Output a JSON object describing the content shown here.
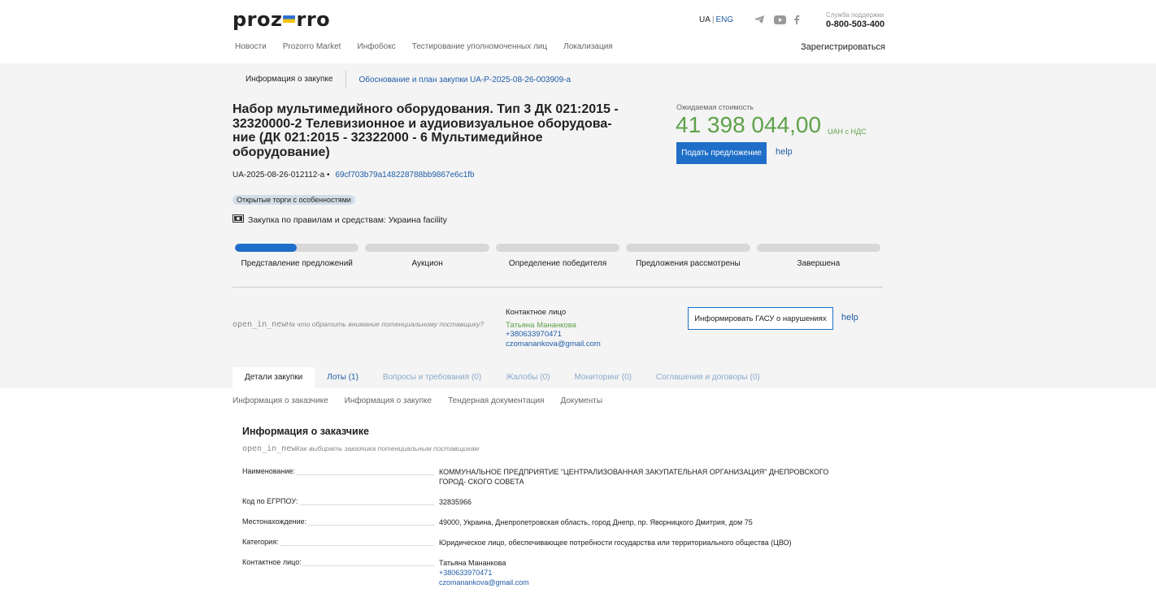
{
  "header": {
    "logo": "prozorro",
    "lang_ua": "UA",
    "lang_eng": "ENG",
    "support_label": "Служба поддержки",
    "support_phone": "0-800-503-400",
    "nav": [
      "Новости",
      "Prozorro Market",
      "Инфобокс",
      "Тестирование уполномоченных лиц",
      "Локализация"
    ],
    "register": "Зарегистрироваться",
    "icons": [
      "telegram-icon",
      "youtube-icon",
      "facebook-icon"
    ]
  },
  "subtabs": {
    "info": "Информация о закупке",
    "plan": "Обоснование и план закупки UA-P-2025-08-26-003909-a"
  },
  "tender": {
    "title": "Набор мультимедийного оборудования. Тип 3 ДК 021:2015 - 32320000-2 Телевизионное и аудиовизуальное оборудова- ние (ДК 021:2015 - 32322000 - 6 Мультимедийное оборудование)",
    "id": "UA-2025-08-26-012112-a",
    "bullet": "•",
    "hash": "69cf703b79a148228788bb9867e6c1fb",
    "badge": "Открытые торги с особенностями",
    "rules": "Закупка по правилам и средствам: Украина facility",
    "expected_label": "Ожидаемая стоимость",
    "price": "41 398 044,00",
    "currency": "UAH с НДС",
    "offer_button": "Подать предложение",
    "help": "help"
  },
  "progress": {
    "current_fraction": 0.5,
    "steps": [
      "Представление предложений",
      "Аукцион",
      "Определение победителя",
      "Предложения рассмотрены",
      "Завершена"
    ]
  },
  "notice": {
    "open_icon_text": "open_in_new",
    "hint": "На что обратить внимание потенциальному поставщику?",
    "contact_header": "Контактное лицо",
    "contact_name": "Татьяна Мананкова",
    "contact_phone": "+380633970471",
    "contact_email": "czomanankova@gmail.com",
    "gasu_button": "Информировать ГАСУ о нарушениях",
    "help": "help"
  },
  "tabs": [
    {
      "label": "Детали закупки"
    },
    {
      "label": "Лоты (1)"
    },
    {
      "label": "Вопросы и требования (0)"
    },
    {
      "label": "Жалобы (0)"
    },
    {
      "label": "Мониторинг (0)"
    },
    {
      "label": "Соглашения и договоры (0)"
    }
  ],
  "subnav": [
    "Информация о заказчике",
    "Информация о закупке",
    "Тендерная документация",
    "Документы"
  ],
  "customer": {
    "title": "Информация о заказчике",
    "open_icon_text": "open_in_new",
    "hint": "Как выбирать заказчика потенциальным поставщикам",
    "rows": [
      {
        "key": "Наименование:",
        "value": "КОММУНАЛЬНОЕ ПРЕДПРИЯТИЕ \"ЦЕНТРАЛИЗОВАННАЯ ЗАКУПАТЕЛЬНАЯ ОРГАНИЗАЦИЯ\" ДНЕПРОВСКОГО ГОРОД- СКОГО СОВЕТА"
      },
      {
        "key": "Код по ЕГРПОУ:",
        "value": "32835966"
      },
      {
        "key": "Местонахождение:",
        "value": "49000, Украина, Днепропетровская область, город Днепр, пр. Яворницкого Дмитрия, дом 75"
      },
      {
        "key": "Категория:",
        "value": "Юридическое лицо, обеспечивающее потребности государства или территориального общества (ЦВО)"
      },
      {
        "key": "Контактное лицо:",
        "value": "Татьяна Мананкова",
        "phone": "+380633970471",
        "email": "czomanankova@gmail.com"
      }
    ]
  }
}
